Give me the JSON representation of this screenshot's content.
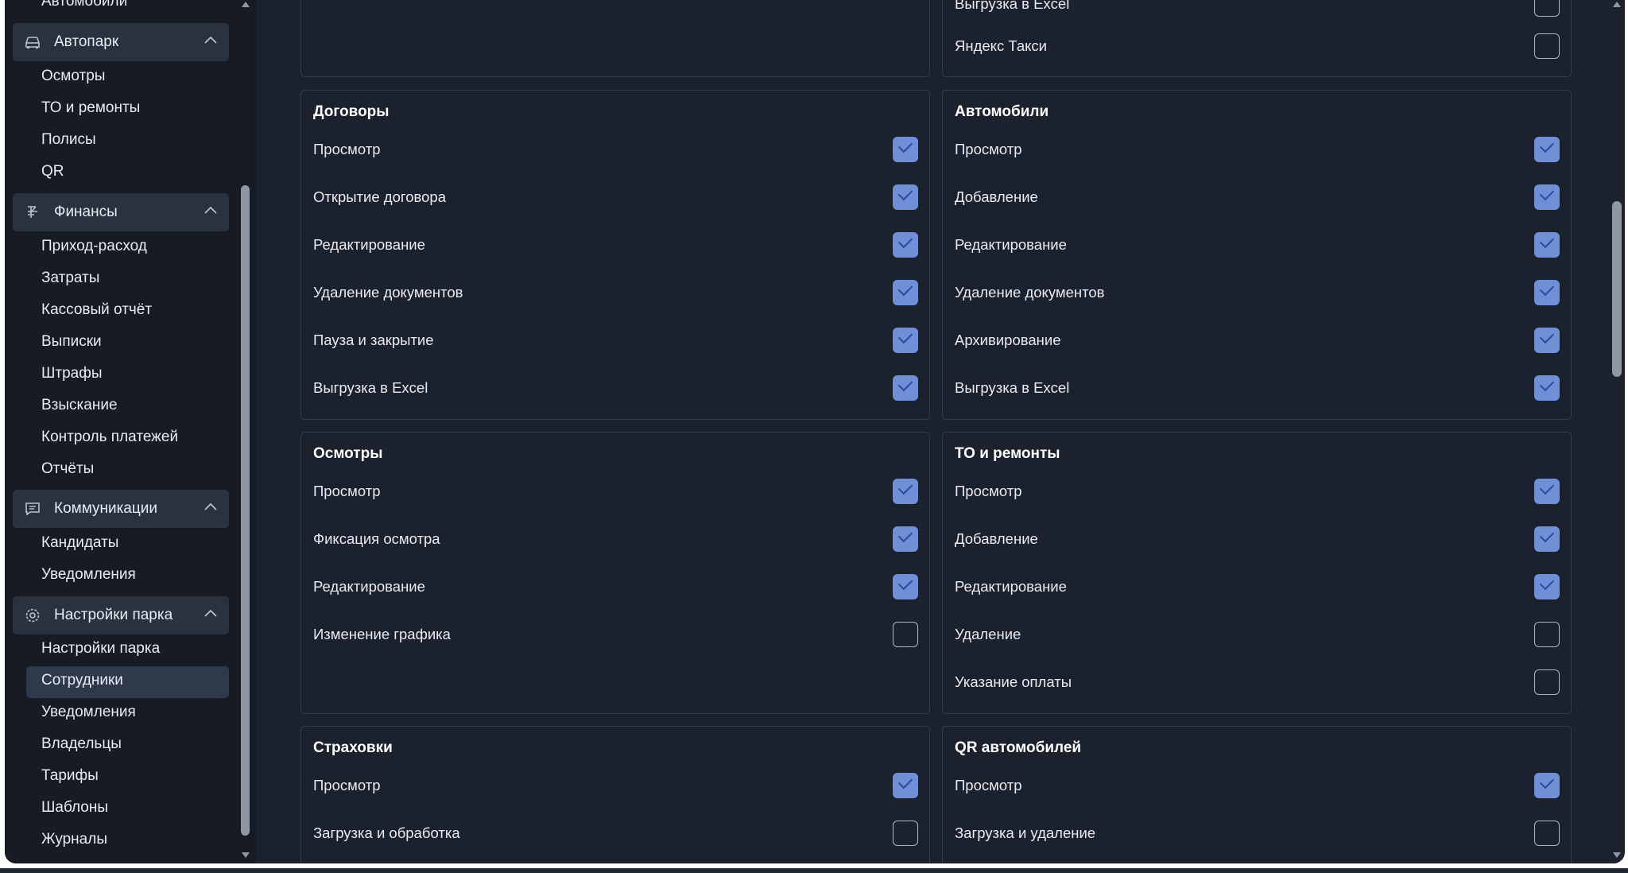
{
  "sidebar": {
    "top_item": "Автомобили",
    "groups": [
      {
        "label": "Автопарк",
        "icon": "car-icon",
        "items": [
          "Осмотры",
          "ТО и ремонты",
          "Полисы",
          "QR"
        ]
      },
      {
        "label": "Финансы",
        "icon": "finance-icon",
        "items": [
          "Приход-расход",
          "Затраты",
          "Кассовый отчёт",
          "Выписки",
          "Штрафы",
          "Взыскание",
          "Контроль платежей",
          "Отчёты"
        ]
      },
      {
        "label": "Коммуникации",
        "icon": "chat-icon",
        "items": [
          "Кандидаты",
          "Уведомления"
        ]
      },
      {
        "label": "Настройки парка",
        "icon": "gear-icon",
        "items": [
          "Настройки парка",
          "Сотрудники",
          "Уведомления",
          "Владельцы",
          "Тарифы",
          "Шаблоны",
          "Журналы"
        ],
        "active_item": "Сотрудники"
      }
    ]
  },
  "cards": {
    "top_left": {
      "rows": []
    },
    "top_right": {
      "rows": [
        {
          "label": "Выгрузка в Excel",
          "checked": false
        },
        {
          "label": "Яндекс Такси",
          "checked": false
        }
      ]
    },
    "contracts": {
      "title": "Договоры",
      "rows": [
        {
          "label": "Просмотр",
          "checked": true
        },
        {
          "label": "Открытие договора",
          "checked": true
        },
        {
          "label": "Редактирование",
          "checked": true
        },
        {
          "label": "Удаление документов",
          "checked": true
        },
        {
          "label": "Пауза и закрытие",
          "checked": true
        },
        {
          "label": "Выгрузка в Excel",
          "checked": true
        }
      ]
    },
    "cars": {
      "title": "Автомобили",
      "rows": [
        {
          "label": "Просмотр",
          "checked": true
        },
        {
          "label": "Добавление",
          "checked": true
        },
        {
          "label": "Редактирование",
          "checked": true
        },
        {
          "label": "Удаление документов",
          "checked": true
        },
        {
          "label": "Архивирование",
          "checked": true
        },
        {
          "label": "Выгрузка в Excel",
          "checked": true
        }
      ]
    },
    "inspections": {
      "title": "Осмотры",
      "rows": [
        {
          "label": "Просмотр",
          "checked": true
        },
        {
          "label": "Фиксация осмотра",
          "checked": true
        },
        {
          "label": "Редактирование",
          "checked": true
        },
        {
          "label": "Изменение графика",
          "checked": false
        }
      ]
    },
    "maintenance": {
      "title": "ТО и ремонты",
      "rows": [
        {
          "label": "Просмотр",
          "checked": true
        },
        {
          "label": "Добавление",
          "checked": true
        },
        {
          "label": "Редактирование",
          "checked": true
        },
        {
          "label": "Удаление",
          "checked": false
        },
        {
          "label": "Указание оплаты",
          "checked": false
        }
      ]
    },
    "insurance": {
      "title": "Страховки",
      "rows": [
        {
          "label": "Просмотр",
          "checked": true
        },
        {
          "label": "Загрузка и обработка",
          "checked": false
        }
      ]
    },
    "qr": {
      "title": "QR автомобилей",
      "rows": [
        {
          "label": "Просмотр",
          "checked": true
        },
        {
          "label": "Загрузка и удаление",
          "checked": false
        }
      ]
    }
  },
  "colors": {
    "background": "#1c222d",
    "sidebar": "#161b24",
    "checkbox_checked": "#6f8fd7",
    "card_border": "#343d4b"
  }
}
